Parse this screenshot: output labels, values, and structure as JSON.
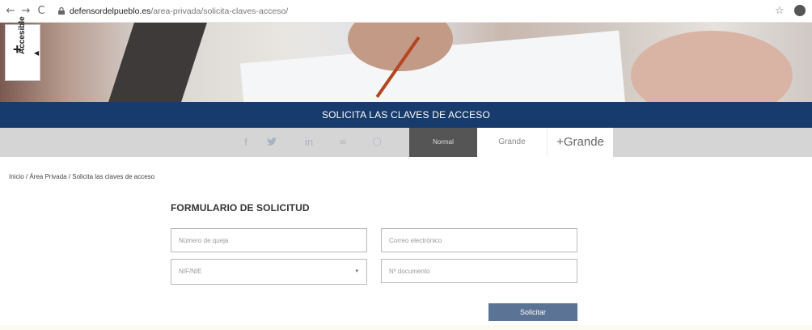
{
  "browser": {
    "back_icon": "←",
    "forward_icon": "→",
    "reload_icon": "C",
    "url_host": "defensordelpueblo.es",
    "url_path": "/area-privada/solicita-claves-acceso/",
    "star_icon": "☆"
  },
  "accessibility": {
    "plus": "+",
    "label": "Accesible",
    "arrow": "◀"
  },
  "page": {
    "title": "SOLICITA LAS CLAVES DE ACCESO"
  },
  "toolbar": {
    "social": [
      "f",
      "🐦",
      "in",
      "✉",
      "◯"
    ],
    "size_normal": "Normal",
    "size_grande": "Grande",
    "size_mas_grande": "+Grande"
  },
  "breadcrumb": "Inicio / Área Privada / Solicita las claves de acceso",
  "form": {
    "title": "FORMULARIO DE SOLICITUD",
    "queja_placeholder": "Número de queja",
    "correo_placeholder": "Correo electrónico",
    "tipo_doc_selected": "NIF/NIE",
    "tipo_doc_caret": "▾",
    "documento_placeholder": "Nº documento",
    "submit_label": "Solicitar"
  },
  "colors": {
    "primary": "#173b6c",
    "button": "#5b7394",
    "tool_bar": "#d5d5d5"
  }
}
